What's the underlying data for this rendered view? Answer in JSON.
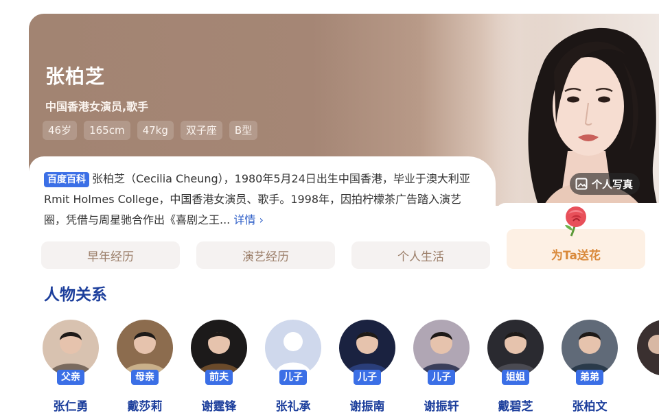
{
  "profile": {
    "name": "张柏芝",
    "subtitle": "中国香港女演员,歌手",
    "tags": [
      "46岁",
      "165cm",
      "47kg",
      "双子座",
      "B型"
    ],
    "photo_button": "个人写真"
  },
  "description": {
    "badge": "百度百科",
    "text": "张柏芝（Cecilia Cheung），1980年5月24日出生中国香港，毕业于澳大利亚Rmit Holmes College，中国香港女演员、歌手。1998年，因拍柠檬茶广告踏入演艺圈，凭借与周星驰合作出《喜剧之王...",
    "more": "详情 ›"
  },
  "tabs": [
    "早年经历",
    "演艺经历",
    "个人生活"
  ],
  "flower": {
    "label": "为Ta送花"
  },
  "relations": {
    "title": "人物关系",
    "people": [
      {
        "relation": "父亲",
        "name": "张仁勇"
      },
      {
        "relation": "母亲",
        "name": "戴莎莉"
      },
      {
        "relation": "前夫",
        "name": "谢霆锋"
      },
      {
        "relation": "儿子",
        "name": "张礼承"
      },
      {
        "relation": "儿子",
        "name": "谢振南"
      },
      {
        "relation": "儿子",
        "name": "谢振轩"
      },
      {
        "relation": "姐姐",
        "name": "戴碧芝"
      },
      {
        "relation": "弟弟",
        "name": "张柏文"
      }
    ]
  },
  "colors": {
    "hero_brown": "#a28472",
    "accent_blue": "#3b6fe6",
    "title_blue": "#1d3f9c",
    "flower_orange": "#d9893a"
  }
}
